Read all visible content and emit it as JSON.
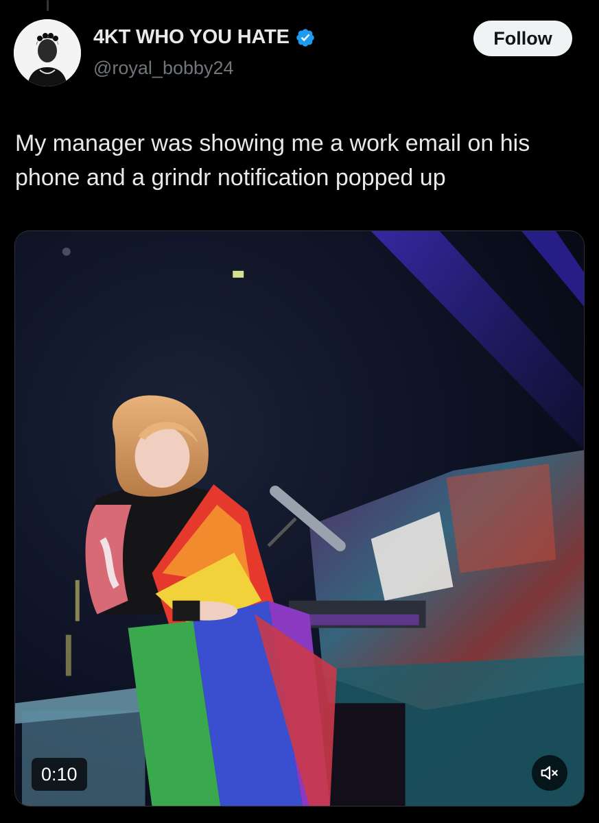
{
  "author": {
    "display_name": "4KT WHO YOU HATE",
    "handle": "@royal_bobby24",
    "verified": true,
    "avatar_icon": "profile-avatar"
  },
  "actions": {
    "follow_label": "Follow"
  },
  "tweet": {
    "text": "My manager was showing me a work email on his phone and a grindr notification popped up"
  },
  "media": {
    "type": "video",
    "description_icon": "video-frame-performer-with-rainbow-flag-at-piano",
    "duration": "0:10",
    "mute_icon": "volume-muted-icon"
  },
  "colors": {
    "background": "#000000",
    "text": "#e7e9ea",
    "secondary": "#71767b",
    "verified_blue": "#1d9bf0",
    "follow_bg": "#eff3f4"
  }
}
